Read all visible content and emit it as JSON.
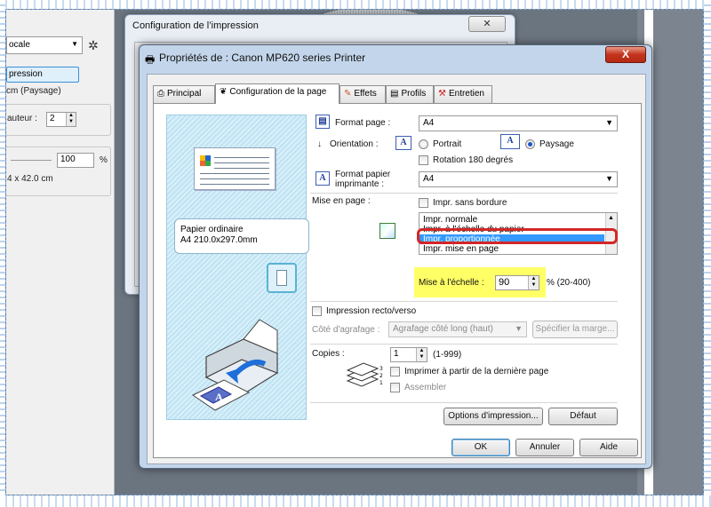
{
  "background_window": {
    "select_value": "ocale",
    "button_label": "pression",
    "paper_text": "cm (Paysage)",
    "height_label": "auteur :",
    "height_value": "2",
    "scale_value": "100",
    "scale_unit": "%",
    "size_text": "4 x 42.0 cm"
  },
  "config_dialog": {
    "title": "Configuration de l’impression"
  },
  "props_dialog": {
    "title": "Propriétés de : Canon MP620 series Printer",
    "close_label": "X",
    "tabs": [
      {
        "label": "Principal",
        "icon": "printer-icon"
      },
      {
        "label": "Configuration de la page",
        "icon": "page-setup-icon"
      },
      {
        "label": "Effets",
        "icon": "effects-icon"
      },
      {
        "label": "Profils",
        "icon": "profiles-icon"
      },
      {
        "label": "Entretien",
        "icon": "maintenance-icon"
      }
    ],
    "preview": {
      "paper_type": "Papier ordinaire",
      "paper_size": "A4 210.0x297.0mm"
    },
    "page_format": {
      "label": "Format page :",
      "value": "A4"
    },
    "orientation": {
      "label": "Orientation :",
      "portrait": "Portrait",
      "landscape": "Paysage",
      "selected": "Paysage",
      "rotate_label": "Rotation 180 degrés"
    },
    "printer_paper": {
      "label_line1": "Format papier",
      "label_line2": "imprimante :",
      "value": "A4"
    },
    "layout": {
      "label": "Mise en page :",
      "borderless_label": "Impr. sans bordure",
      "options": [
        "Impr. normale",
        "Impr. à l'échelle du papier",
        "Impr. proportionnée",
        "Impr. mise en page"
      ],
      "selected": "Impr. proportionnée"
    },
    "scaling": {
      "label": "Mise à l'échelle :",
      "value": "90",
      "range": "% (20-400)"
    },
    "duplex": {
      "label": "Impression recto/verso",
      "staple_label": "Côté d'agrafage :",
      "staple_value": "Agrafage côté long (haut)",
      "margin_button": "Spécifier la marge..."
    },
    "copies": {
      "label": "Copies :",
      "value": "1",
      "range": "(1-999)",
      "last_page_label": "Imprimer à partir de la dernière page",
      "collate_label": "Assembler"
    },
    "buttons": {
      "print_options": "Options d'impression...",
      "default": "Défaut",
      "ok": "OK",
      "cancel": "Annuler",
      "help": "Aide"
    }
  }
}
